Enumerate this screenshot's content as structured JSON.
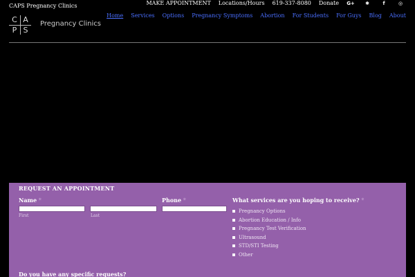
{
  "site": {
    "name": "CAPS Pregnancy Clinics"
  },
  "top_links": {
    "appointment": "MAKE APPOINTMENT",
    "locations": "Locations/Hours",
    "phone": "619-337-8080",
    "donate": "Donate",
    "social": [
      {
        "icon": "google-plus-icon",
        "glyph": "G+"
      },
      {
        "icon": "yelp-icon",
        "glyph": "✱"
      },
      {
        "icon": "facebook-icon",
        "glyph": "f"
      },
      {
        "icon": "instagram-icon",
        "glyph": "◎"
      }
    ]
  },
  "logo": {
    "letters": [
      "C",
      "A",
      "P",
      "S"
    ],
    "text": "Pregnancy Clinics"
  },
  "nav": {
    "items": [
      "Home",
      "Services",
      "Options",
      "Pregnancy Symptoms",
      "Abortion",
      "For Students",
      "For Guys",
      "Blog",
      "About"
    ],
    "active_index": 0,
    "color": "#4a6fff"
  },
  "form": {
    "title": "REQUEST AN APPOINTMENT",
    "background": "#9460aa",
    "name_label": "Name",
    "required_mark": "*",
    "first_label": "First",
    "last_label": "Last",
    "first_value": "",
    "last_value": "",
    "phone_label": "Phone",
    "phone_value": "",
    "services_label": "What services are you hoping to receive?",
    "services": [
      "Pregnancy Options",
      "Abortion Education / Info",
      "Pregnancy Test Verification",
      "Ultrasound",
      "STD/STI Testing",
      "Other"
    ],
    "requests_label": "Do you have any specific requests?"
  }
}
